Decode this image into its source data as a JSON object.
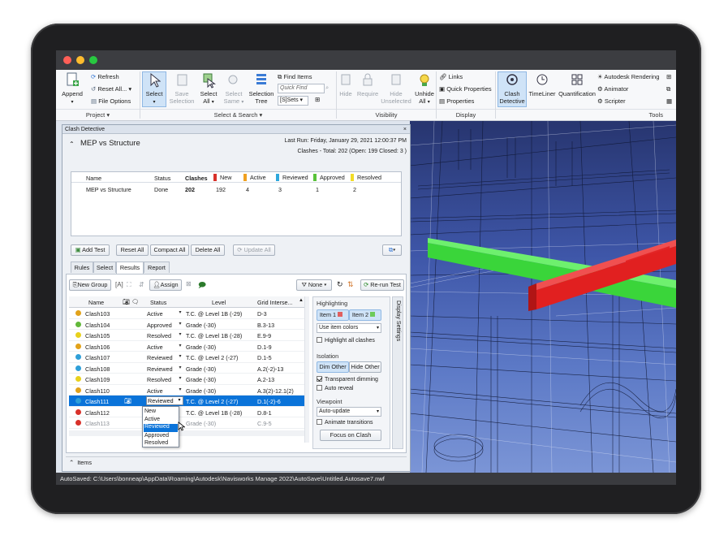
{
  "ribbon": {
    "project": {
      "append": "Append",
      "refresh": "Refresh",
      "reset_all": "Reset All...",
      "file_options": "File Options",
      "group_label": "Project ▾"
    },
    "select_search": {
      "select": "Select",
      "save_selection_1": "Save",
      "save_selection_2": "Selection",
      "select_all_1": "Select",
      "select_all_2": "All",
      "select_same_1": "Select",
      "select_same_2": "Same",
      "selection_tree_1": "Selection",
      "selection_tree_2": "Tree",
      "find_items": "Find Items",
      "quick_find": "Quick Find",
      "sets": "Sets",
      "group_label": "Select & Search ▾"
    },
    "visibility": {
      "hide": "Hide",
      "require": "Require",
      "hide_unselected_1": "Hide",
      "hide_unselected_2": "Unselected",
      "unhide_all_1": "Unhide",
      "unhide_all_2": "All",
      "group_label": "Visibility"
    },
    "display": {
      "links": "Links",
      "quick_properties": "Quick Properties",
      "properties": "Properties",
      "group_label": "Display"
    },
    "tools": {
      "clash_detective_1": "Clash",
      "clash_detective_2": "Detective",
      "timeliner": "TimeLiner",
      "quantification": "Quantification",
      "autodesk_rendering": "Autodesk Rendering",
      "animator": "Animator",
      "scripter": "Scripter",
      "group_label": "Tools"
    }
  },
  "clash_panel": {
    "title": "Clash Detective",
    "close": "×",
    "test_name": "MEP vs Structure",
    "last_run_label": "Last Run:",
    "last_run_value": "Friday, January 29, 2021 12:00:37 PM",
    "summary": "Clashes - Total: 202 (Open: 199 Closed: 3 )",
    "tests_table": {
      "headers": [
        "Name",
        "Status",
        "Clashes",
        "New",
        "Active",
        "Reviewed",
        "Approved",
        "Resolved"
      ],
      "row": [
        "MEP vs Structure",
        "Done",
        "202",
        "192",
        "4",
        "3",
        "1",
        "2"
      ]
    },
    "buttons": {
      "add_test": "Add Test",
      "reset_all": "Reset All",
      "compact_all": "Compact All",
      "delete_all": "Delete All",
      "update_all": "Update All"
    },
    "tabs": [
      "Rules",
      "Select",
      "Results",
      "Report"
    ],
    "results_toolbar": {
      "new_group": "New Group",
      "assign": "Assign",
      "none": "None",
      "rerun": "Re-run Test"
    },
    "results": {
      "headers": [
        "Name",
        "Status",
        "Level",
        "Grid Interse..."
      ],
      "rows": [
        {
          "name": "Clash103",
          "dot": "#e2a21a",
          "status": "Active",
          "level": "T.C. @ Level 1B (-29)",
          "grid": "D-3"
        },
        {
          "name": "Clash104",
          "dot": "#62b83a",
          "status": "Approved",
          "level": "Grade (-30)",
          "grid": "B.3-13"
        },
        {
          "name": "Clash105",
          "dot": "#e8d11c",
          "status": "Resolved",
          "level": "T.C. @ Level 1B (-28)",
          "grid": "E.9-9"
        },
        {
          "name": "Clash106",
          "dot": "#e2a21a",
          "status": "Active",
          "level": "Grade (-30)",
          "grid": "D.1-9"
        },
        {
          "name": "Clash107",
          "dot": "#2f9fd8",
          "status": "Reviewed",
          "level": "T.C. @ Level 2 (-27)",
          "grid": "D.1-5"
        },
        {
          "name": "Clash108",
          "dot": "#2f9fd8",
          "status": "Reviewed",
          "level": "Grade (-30)",
          "grid": "A.2(-2)-13"
        },
        {
          "name": "Clash109",
          "dot": "#e8d11c",
          "status": "Resolved",
          "level": "Grade (-30)",
          "grid": "A.2-13"
        },
        {
          "name": "Clash110",
          "dot": "#e2a21a",
          "status": "Active",
          "level": "Grade (-30)",
          "grid": "A.3(2)-12.1(2)"
        },
        {
          "name": "Clash111",
          "dot": "#2f9fd8",
          "status": "Reviewed",
          "level": "T.C. @ Level 2 (-27)",
          "grid": "D.1(-2)-6"
        },
        {
          "name": "Clash112",
          "dot": "#d8312a",
          "status": "",
          "level": "T.C. @ Level 1B (-28)",
          "grid": "D.8-1"
        },
        {
          "name": "Clash113",
          "dot": "#d8312a",
          "status": "",
          "level": "Grade (-30)",
          "grid": "C.9-5"
        }
      ],
      "dropdown": [
        "New",
        "Active",
        "Reviewed",
        "Approved",
        "Resolved"
      ]
    },
    "display_settings": {
      "side_label": "Display Settings",
      "highlighting": "Highlighting",
      "item1": "Item 1",
      "item2": "Item 2",
      "use_item_colors": "Use item colors",
      "highlight_all": "Highlight all clashes",
      "isolation": "Isolation",
      "dim_other": "Dim Other",
      "hide_other": "Hide Other",
      "transparent_dimming": "Transparent dimming",
      "auto_reveal": "Auto reveal",
      "viewpoint": "Viewpoint",
      "auto_update": "Auto-update",
      "animate_transitions": "Animate transitions",
      "focus_on_clash": "Focus on Clash"
    },
    "items_label": "Items"
  },
  "status_bar": "AutoSaved: C:\\Users\\bonneap\\AppData\\Roaming\\Autodesk\\Navisworks Manage 2022\\AutoSave\\Untitled.Autosave7.nwf",
  "colors": {
    "new": "#d8312a",
    "active": "#f0a020",
    "reviewed": "#2fa8dc",
    "approved": "#59c23a",
    "resolved": "#f2dc27",
    "selection": "#0a73d9"
  }
}
